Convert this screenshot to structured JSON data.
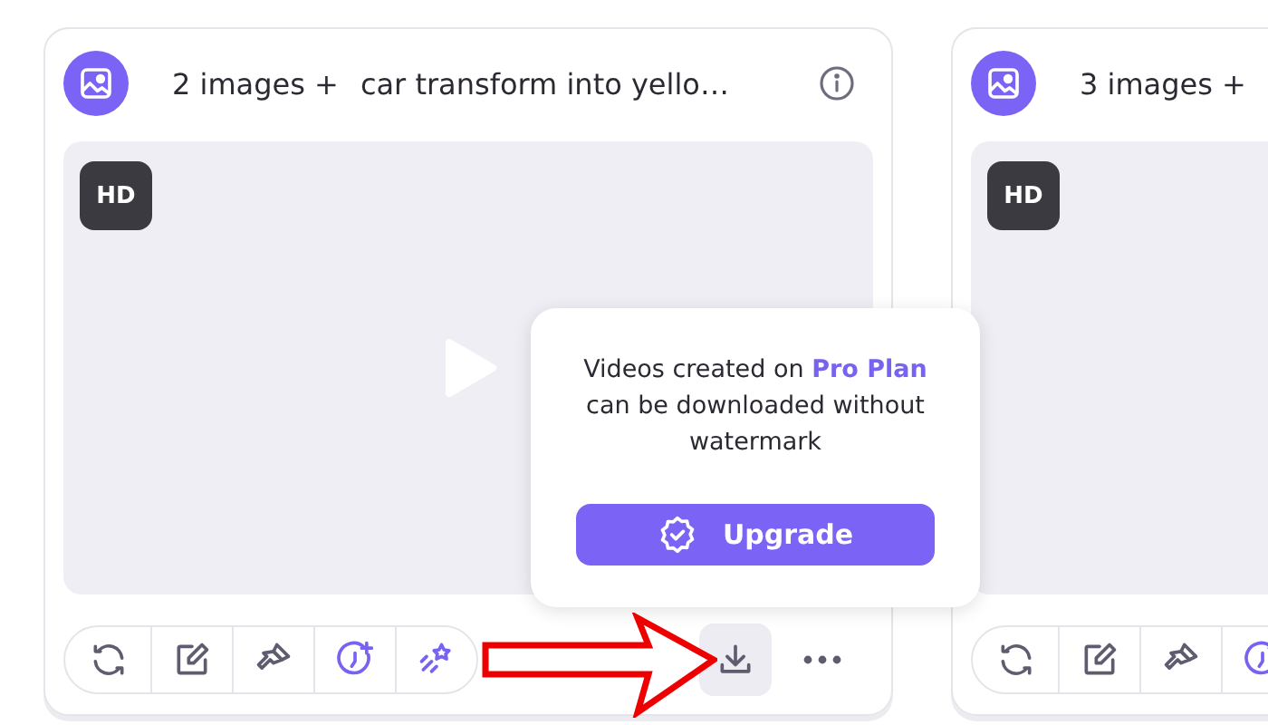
{
  "cards": [
    {
      "prefix": "2 images +",
      "prompt": "car transform into yello…",
      "info": true,
      "badge": "HD",
      "tools": [
        {
          "kind": "refresh"
        },
        {
          "kind": "edit"
        },
        {
          "kind": "brush"
        },
        {
          "kind": "timer"
        },
        {
          "kind": "magic"
        }
      ],
      "actions": [
        {
          "kind": "download",
          "selected": true
        },
        {
          "kind": "more",
          "selected": false
        }
      ]
    },
    {
      "prefix": "3 images +",
      "info": false,
      "badge": "HD",
      "tools": [
        {
          "kind": "refresh"
        },
        {
          "kind": "edit"
        },
        {
          "kind": "brush"
        },
        {
          "kind": "timer"
        }
      ]
    }
  ],
  "popup": {
    "message": "Videos created on **Pro Plan** can be downloaded without watermark",
    "button": "Upgrade"
  }
}
